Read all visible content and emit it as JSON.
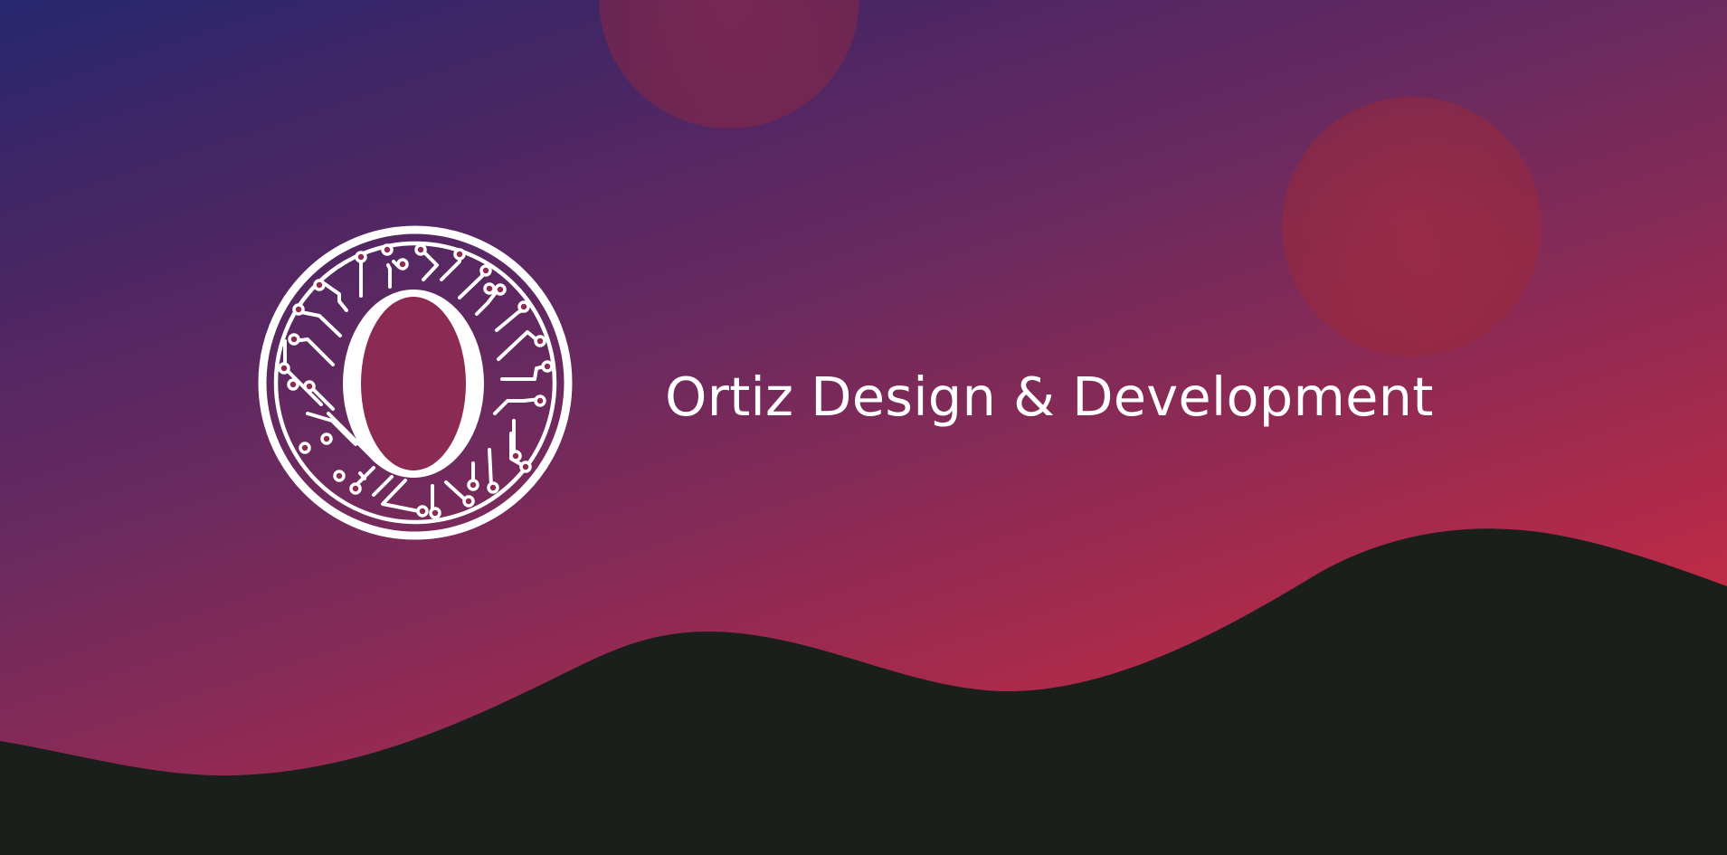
{
  "brand": {
    "name": "Ortiz Design & Development",
    "logo_monogram": "O",
    "logo_icon": "circuit-monogram-icon"
  },
  "colors": {
    "gradient_start": "#27276e",
    "gradient_mid": "#8b2a56",
    "gradient_end": "#e12c3c",
    "wave": "#1b1f1b",
    "logo": "#ffffff",
    "text": "#ffffff"
  }
}
